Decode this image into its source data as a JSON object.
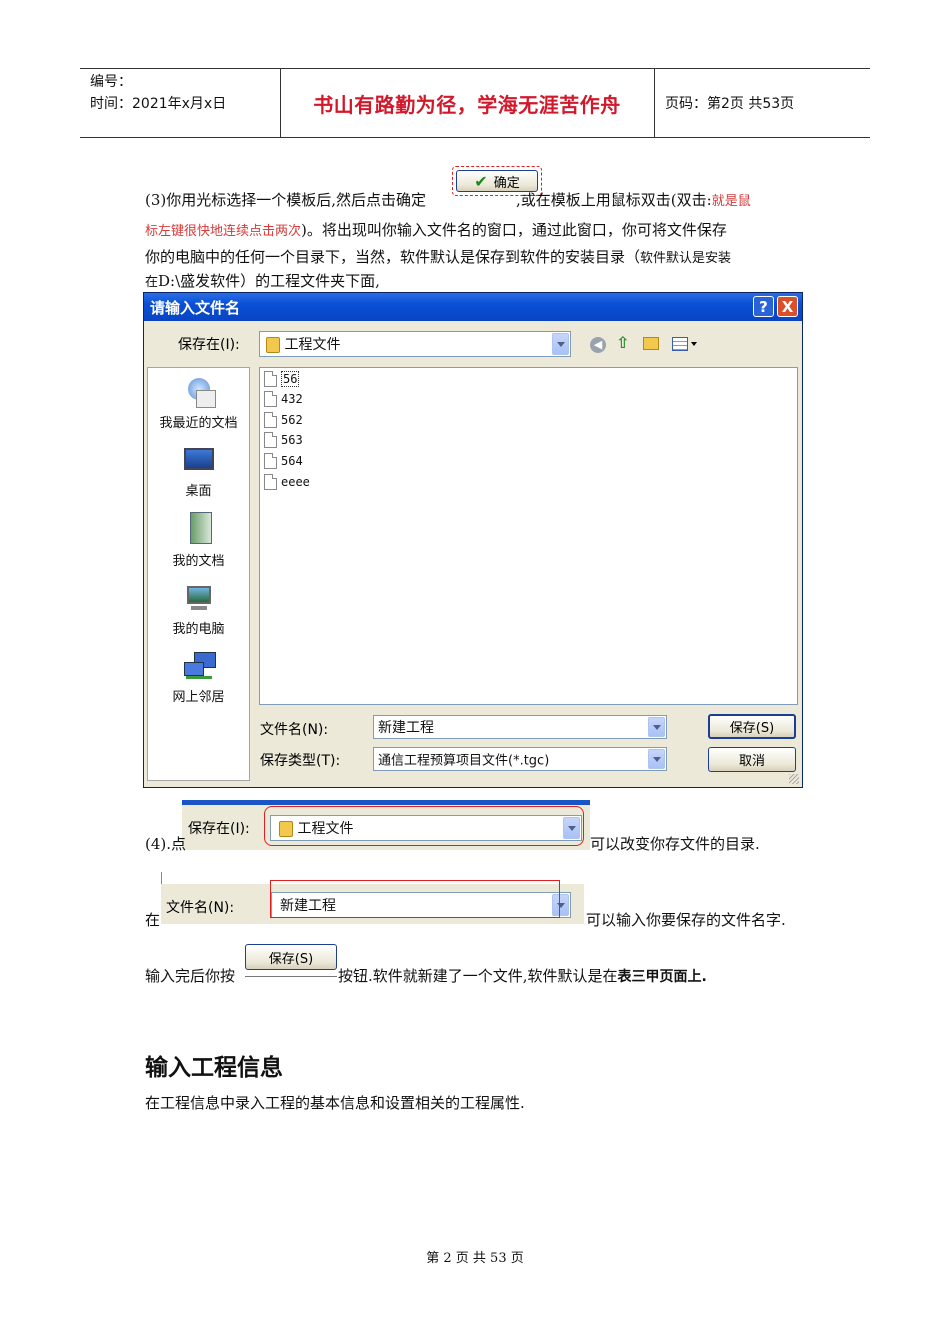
{
  "header": {
    "number_label": "编号：",
    "time_label": "时间：2021年x月x日",
    "motto": "书山有路勤为径，学海无涯苦作舟",
    "page_label": "页码：第2页  共53页"
  },
  "step3": {
    "line1_a": "(3)你用光标选择一个模板后,然后点击确定",
    "line1_b": ",或在模板上用鼠标双击(双击:",
    "line1_red": "就是鼠",
    "line2_red": "标左键很快地连续点击两次",
    "line2_b": ")。将出现叫你输入文件名的窗口，通过此窗口，你可将文件保存",
    "line3": "你的电脑中的任何一个目录下，当然，软件默认是保存到软件的安装目录（",
    "line3_small": "软件默认是安装",
    "line4_small": "在",
    "line4": "D:\\盛发软件）的工程文件夹下面,",
    "ok_button": "确定"
  },
  "dialog": {
    "title": "请输入文件名",
    "help_btn": "?",
    "close_btn": "X",
    "save_in_label": "保存在(I):",
    "save_in_value": "工程文件",
    "places": [
      "我最近的文档",
      "桌面",
      "我的文档",
      "我的电脑",
      "网上邻居"
    ],
    "files": [
      "56",
      "432",
      "562",
      "563",
      "564",
      "eeee"
    ],
    "filename_label": "文件名(N):",
    "filename_value": "新建工程",
    "filetype_label": "保存类型(T):",
    "filetype_value": "通信工程预算项目文件(*.tgc)",
    "save_button": "保存(S)",
    "cancel_button": "取消"
  },
  "step4": {
    "prefix": "(4).点",
    "crop_label": "保存在(I):",
    "crop_value": "工程文件",
    "suffix": "可以改变你存文件的目录."
  },
  "step5": {
    "prefix": "在",
    "crop_label": "文件名(N):",
    "crop_value": "新建工程",
    "suffix": "可以输入你要保存的文件名字."
  },
  "step6": {
    "prefix": "输入完后你按",
    "button": "保存(S)",
    "middle": "按钮.软件就新建了一个文件,软件默认是在",
    "bold": "表三甲页面上."
  },
  "section": {
    "heading": "输入工程信息",
    "body": "在工程信息中录入工程的基本信息和设置相关的工程属性."
  },
  "footer": "第 2 页 共 53 页"
}
